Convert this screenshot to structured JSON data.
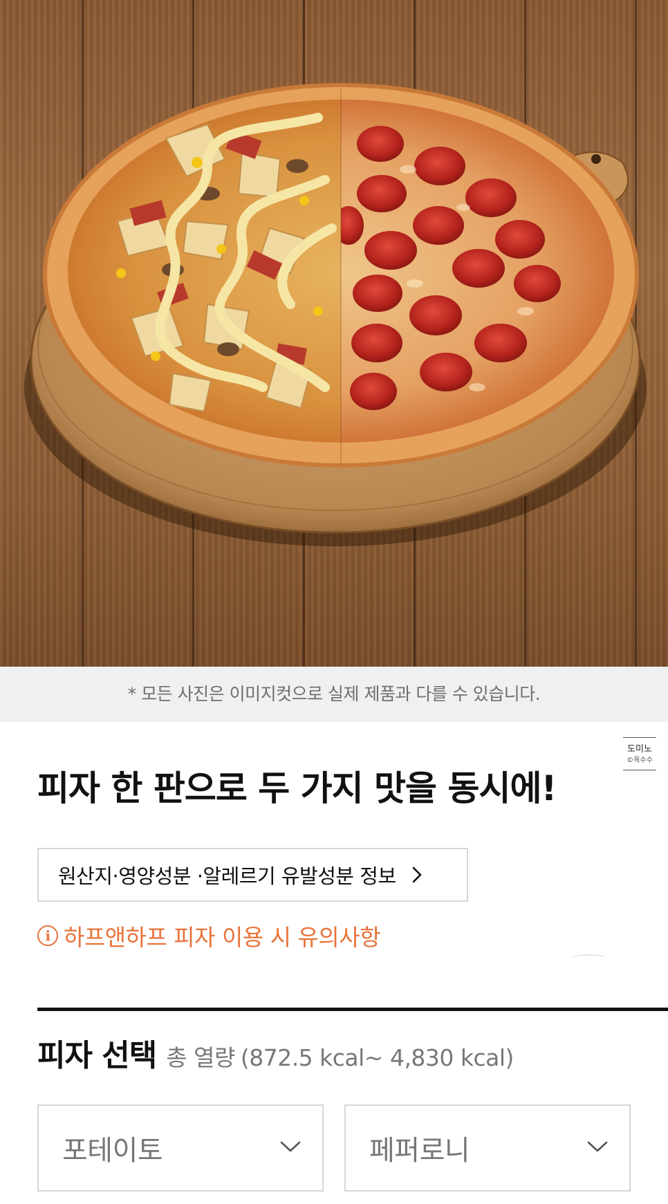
{
  "hero": {
    "image": "half-and-half pizza on wooden board: potato half and pepperoni half"
  },
  "disclaimer": "* 모든 사진은 이미지컷으로 실제 제품과 다를 수 있습니다.",
  "watermark": {
    "line1": "도미노",
    "line2": "©옥수수"
  },
  "headline": "피자 한 판으로 두 가지 맛을 동시에!",
  "info_button": {
    "label": "원산지·영양성분 ·알레르기 유발성분 정보",
    "icon": "chevron-right-icon"
  },
  "notice": {
    "icon": "info-circle-icon",
    "icon_glyph": "i",
    "label": "하프앤하프 피자 이용 시 유의사항"
  },
  "pizza_select": {
    "title": "피자 선택",
    "calorie_label": "총 열량",
    "calorie_range": "(872.5 kcal~ 4,830 kcal)",
    "left": {
      "value": "포테이토",
      "icon": "chevron-down-icon"
    },
    "right": {
      "value": "페퍼로니",
      "icon": "chevron-down-icon"
    }
  },
  "colors": {
    "accent_orange": "#e8733a",
    "text_primary": "#111111",
    "text_muted": "#777777",
    "border": "#d6d6d6",
    "disclaimer_bg": "#f0f0f0"
  }
}
